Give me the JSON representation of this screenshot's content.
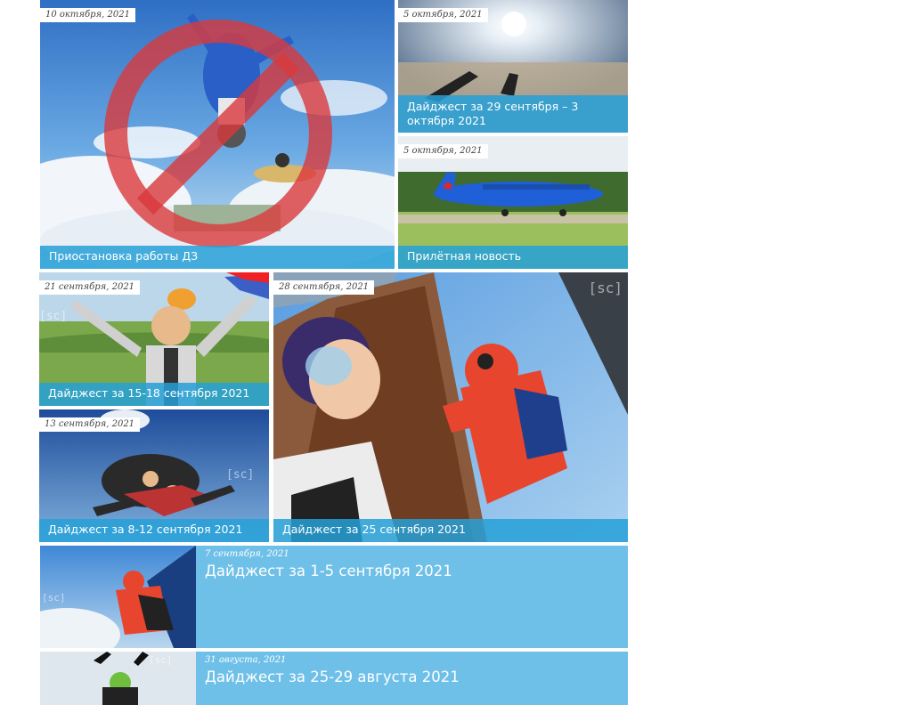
{
  "watermark": "[sc]",
  "featured": [
    {
      "date": "10 октября, 2021",
      "title": "Приостановка работы ДЗ"
    },
    {
      "date": "5 октября, 2021",
      "title": "Дайджест за 29 сентября – 3 октября 2021"
    },
    {
      "date": "5 октября, 2021",
      "title": "Прилётная новость"
    },
    {
      "date": "21 сентября, 2021",
      "title": "Дайджест за 15-18 сентября 2021"
    },
    {
      "date": "28 сентября, 2021",
      "title": "Дайджест за 25 сентября 2021"
    },
    {
      "date": "13 сентября, 2021",
      "title": "Дайджест за 8-12 сентября 2021"
    }
  ],
  "list": [
    {
      "date": "7 сентября, 2021",
      "title": "Дайджест за 1-5 сентября 2021"
    },
    {
      "date": "31 августа, 2021",
      "title": "Дайджест за 25-29 августа 2021"
    }
  ],
  "colors": {
    "caption_bg": "#26a0d7",
    "row_bg": "#6ec0e8",
    "sky": "#3b8fd6"
  }
}
